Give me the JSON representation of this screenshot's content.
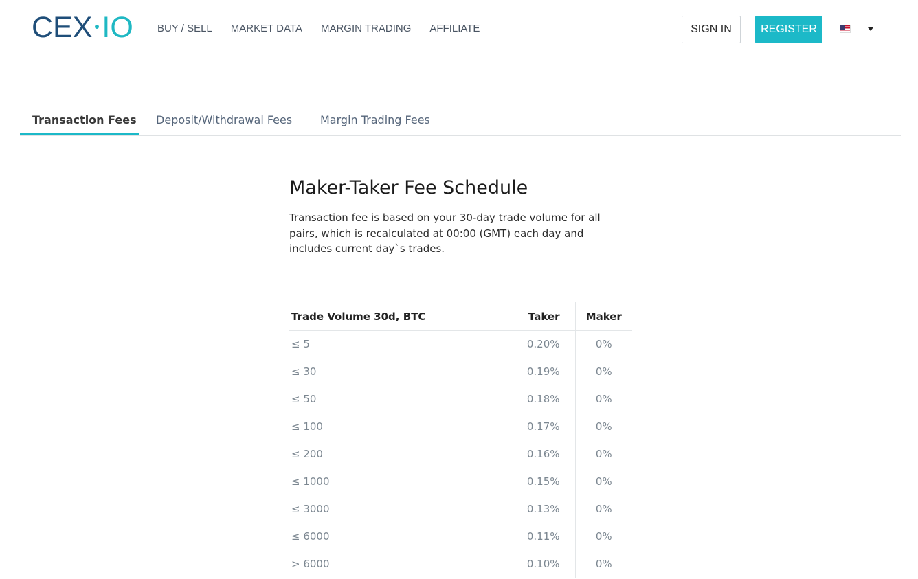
{
  "header": {
    "logo": {
      "left": "CEX",
      "right": "IO"
    },
    "nav": [
      {
        "label": "BUY / SELL"
      },
      {
        "label": "MARKET DATA"
      },
      {
        "label": "MARGIN TRADING"
      },
      {
        "label": "AFFILIATE"
      }
    ],
    "sign_in_label": "SIGN IN",
    "register_label": "REGISTER",
    "language_icon": "us-flag-icon",
    "colors": {
      "accent": "#1cb9c8",
      "logo_dark": "#1f4e79"
    }
  },
  "tabs": [
    {
      "label": "Transaction Fees",
      "active": true
    },
    {
      "label": "Deposit/Withdrawal Fees",
      "active": false
    },
    {
      "label": "Margin Trading Fees",
      "active": false
    }
  ],
  "main": {
    "title": "Maker-Taker Fee Schedule",
    "description": "Transaction fee is based on your 30-day trade volume for all pairs, which is recalculated at 00:00 (GMT) each day and includes current day`s trades."
  },
  "fee_table": {
    "headers": {
      "volume": "Trade Volume 30d, BTC",
      "taker": "Taker",
      "maker": "Maker"
    },
    "rows": [
      {
        "volume": "≤ 5",
        "taker": "0.20%",
        "maker": "0%"
      },
      {
        "volume": "≤ 30",
        "taker": "0.19%",
        "maker": "0%"
      },
      {
        "volume": "≤ 50",
        "taker": "0.18%",
        "maker": "0%"
      },
      {
        "volume": "≤ 100",
        "taker": "0.17%",
        "maker": "0%"
      },
      {
        "volume": "≤ 200",
        "taker": "0.16%",
        "maker": "0%"
      },
      {
        "volume": "≤ 1000",
        "taker": "0.15%",
        "maker": "0%"
      },
      {
        "volume": "≤ 3000",
        "taker": "0.13%",
        "maker": "0%"
      },
      {
        "volume": "≤ 6000",
        "taker": "0.11%",
        "maker": "0%"
      },
      {
        "volume": "> 6000",
        "taker": "0.10%",
        "maker": "0%"
      }
    ]
  }
}
